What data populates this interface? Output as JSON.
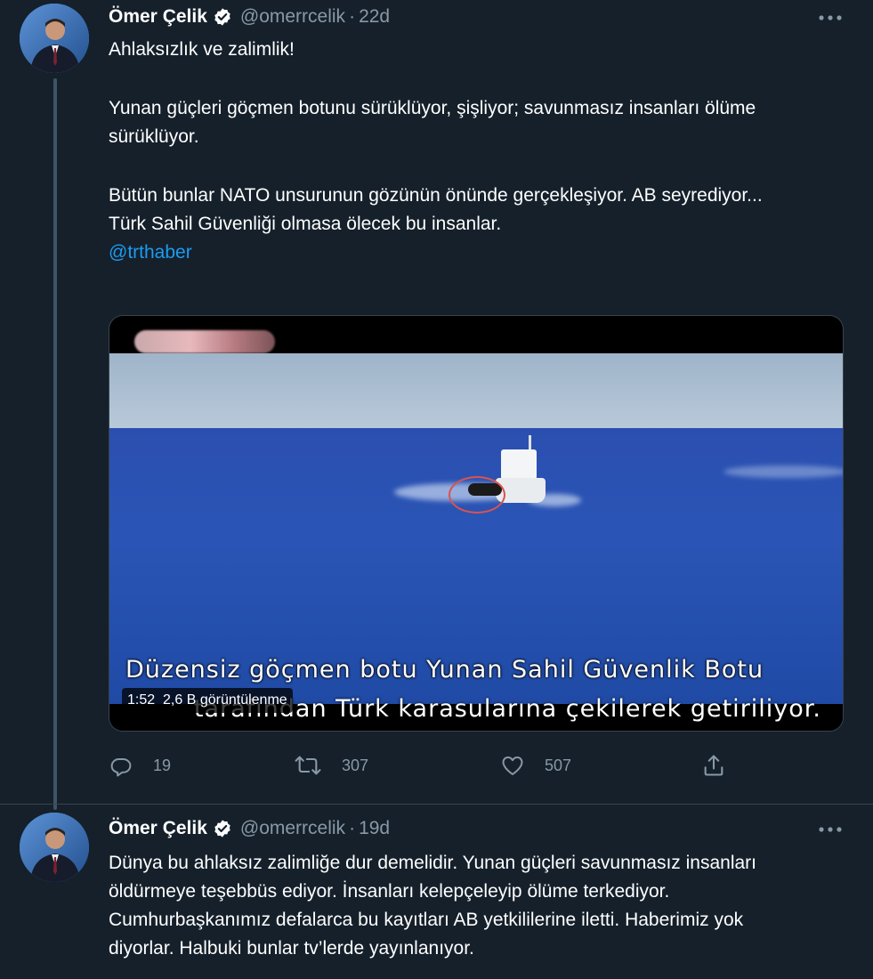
{
  "tweets": [
    {
      "author": {
        "name": "Ömer Çelik",
        "handle": "@omerrcelik",
        "time": "22d"
      },
      "text": {
        "line1": "Ahlaksızlık ve zalimlik!",
        "para2": "Yunan güçleri göçmen botunu sürüklüyor, şişliyor; savunmasız insanları ölüme sürüklüyor.",
        "para3a": "Bütün bunlar NATO unsurunun gözünün önünde gerçekleşiyor. AB seyrediyor...",
        "para3b": "Türk Sahil Güvenliği olmasa ölecek bu insanlar.",
        "mention": "@trthaber"
      },
      "video": {
        "subtitle_line1": "Düzensiz göçmen botu Yunan Sahil Güvenlik Botu",
        "subtitle_line2": "tarafından Türk karasularına çekilerek getiriliyor.",
        "duration": "1:52",
        "views": "2,6 B görüntülenme"
      },
      "counts": {
        "replies": "19",
        "retweets": "307",
        "likes": "507"
      }
    },
    {
      "author": {
        "name": "Ömer Çelik",
        "handle": "@omerrcelik",
        "time": "19d"
      },
      "text": {
        "body": "Dünya bu ahlaksız zalimliğe dur demelidir. Yunan güçleri savunmasız insanları öldürmeye teşebbüs ediyor. İnsanları kelepçeleyip ölüme terkediyor. Cumhurbaşkanımız defalarca bu kayıtları AB yetkililerine iletti. Haberimiz yok diyorlar. Halbuki bunlar tv’lerde yayınlanıyor."
      }
    }
  ],
  "icons": {
    "verified": "verified-badge-icon",
    "more": "more-horizontal-icon",
    "reply": "reply-icon",
    "retweet": "retweet-icon",
    "like": "heart-icon",
    "share": "share-icon"
  },
  "colors": {
    "background": "#15202b",
    "text": "#ffffff",
    "muted": "#8899a6",
    "link": "#1d9bf0",
    "verified": "#ffffff"
  }
}
